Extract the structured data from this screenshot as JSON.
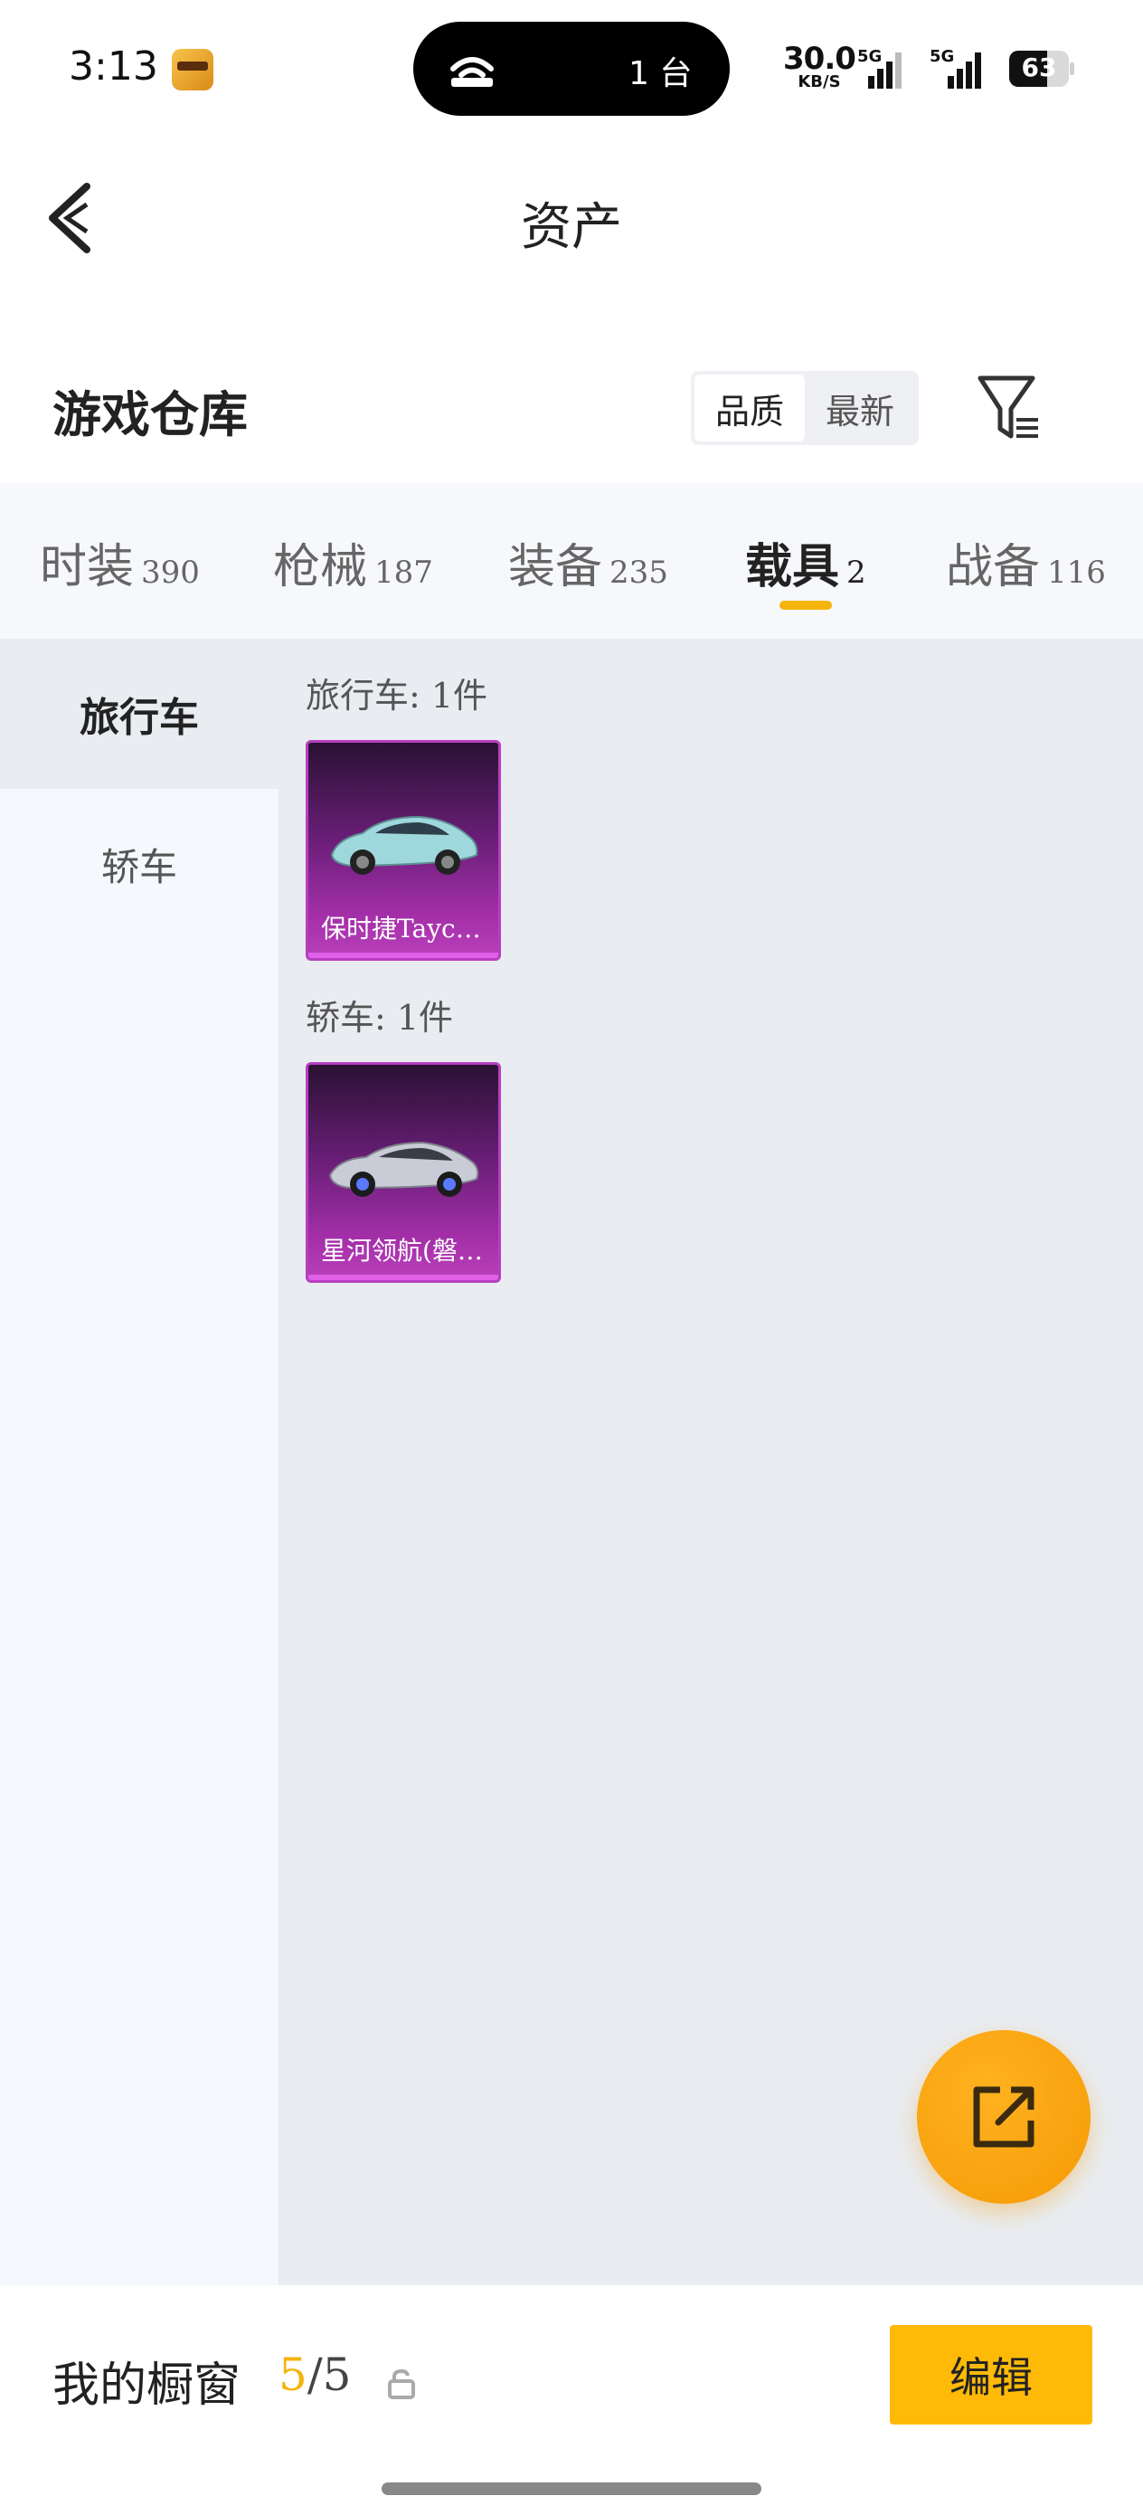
{
  "status_bar": {
    "time": "3:13",
    "island_text": "1 台",
    "net_speed": "30.0",
    "net_unit": "KB/S",
    "signal_1_tag": "5G",
    "signal_2_tag": "5G",
    "battery_level": "63",
    "battery_percent": 63
  },
  "header": {
    "title": "资产",
    "back_icon": "chevron-left-icon"
  },
  "warehouse": {
    "title": "游戏仓库",
    "sort_options": [
      "品质",
      "最新"
    ],
    "sort_selected": "品质",
    "filter_icon": "filter-icon"
  },
  "categories": [
    {
      "label": "时装",
      "count": "390",
      "active": false
    },
    {
      "label": "枪械",
      "count": "187",
      "active": false
    },
    {
      "label": "装备",
      "count": "235",
      "active": false
    },
    {
      "label": "载具",
      "count": "2",
      "active": true
    },
    {
      "label": "战备",
      "count": "116",
      "active": false
    }
  ],
  "side_nav": [
    {
      "label": "旅行车",
      "active": true
    },
    {
      "label": "轿车",
      "active": false
    }
  ],
  "sections": [
    {
      "label": "旅行车: 1件",
      "items": [
        {
          "name": "保时捷Tayca…",
          "color": "#9fd8dc"
        }
      ]
    },
    {
      "label": "轿车: 1件",
      "items": [
        {
          "name": "星河领航(磐…",
          "color": "#c9ccd6"
        }
      ]
    }
  ],
  "fab": {
    "icon": "share-external-icon",
    "color": "#f5a20a"
  },
  "bottom_bar": {
    "label": "我的橱窗",
    "current": "5",
    "separator": "/",
    "total": "5",
    "lock_icon": "unlock-icon",
    "edit_label": "编辑"
  },
  "colors": {
    "accent": "#f5b40c",
    "card_gradient_top": "#2a1133",
    "card_gradient_bottom": "#b940bb"
  }
}
